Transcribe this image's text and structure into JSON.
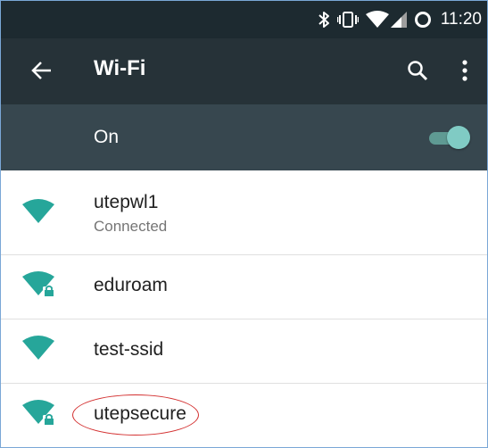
{
  "status_bar": {
    "time": "11:20",
    "icons": [
      "bluetooth-icon",
      "vibrate-icon",
      "wifi-signal-icon",
      "cell-signal-icon",
      "battery-icon"
    ]
  },
  "app_bar": {
    "title": "Wi-Fi",
    "icons": [
      "back-arrow-icon",
      "search-icon",
      "more-vert-icon"
    ]
  },
  "wifi_toggle": {
    "label": "On",
    "state": "on"
  },
  "networks": [
    {
      "ssid": "utepwl1",
      "status": "Connected",
      "secured": false
    },
    {
      "ssid": "eduroam",
      "status": "",
      "secured": true
    },
    {
      "ssid": "test-ssid",
      "status": "",
      "secured": false
    },
    {
      "ssid": "utepsecure",
      "status": "",
      "secured": true,
      "highlighted": true
    }
  ],
  "colors": {
    "status_bar_bg": "#1d2a30",
    "app_bar_bg": "#263238",
    "switch_bar_bg": "#37474f",
    "accent": "#26a69a",
    "highlight_circle": "#d32f2f"
  }
}
